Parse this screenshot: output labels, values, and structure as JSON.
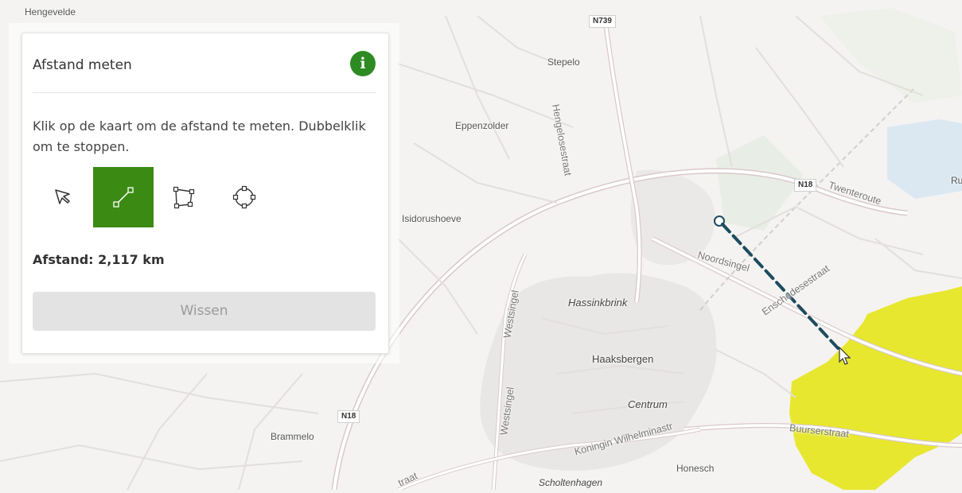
{
  "map": {
    "places": {
      "hengevelde": "Hengevelde",
      "stepelo": "Stepelo",
      "eppenzolder": "Eppenzolder",
      "isidorushoeve": "Isidorushoeve",
      "hassinkbrink": "Hassinkbrink",
      "haaksbergen": "Haaksbergen",
      "centrum": "Centrum",
      "brammelo": "Brammelo",
      "honesch": "Honesch",
      "scholtenhagen": "Scholtenhagen",
      "ru": "Ru"
    },
    "streets": {
      "hengelosestraat": "Hengelosestraat",
      "twenteroute": "Twenteroute",
      "noordsingel": "Noordsingel",
      "enschedesestraat": "Enschedesestraat",
      "westsingel_top": "Westsingel",
      "westsingel_bottom": "Westsingel",
      "koningin_wilhelminastr": "Koningin Wilhelminastr",
      "buurserstraat": "Buurserstraat",
      "straat": "traat"
    },
    "shields": {
      "n739": "N739",
      "n18_east": "N18",
      "n18_west": "N18"
    },
    "colors": {
      "measure_line": "#1d4a5e",
      "highlight_area": "#e6e619"
    }
  },
  "panel": {
    "title": "Afstand meten",
    "info_icon": "i",
    "instructions": "Klik op de kaart om de afstand te meten. Dubbelklik om te stoppen.",
    "tools": [
      {
        "name": "select-arrow-icon",
        "active": false
      },
      {
        "name": "measure-line-icon",
        "active": true
      },
      {
        "name": "measure-polygon-icon",
        "active": false
      },
      {
        "name": "measure-circle-icon",
        "active": false
      }
    ],
    "distance": "Afstand: 2,117 km",
    "clear_label": "Wissen",
    "accent_color": "#3b8a14"
  }
}
